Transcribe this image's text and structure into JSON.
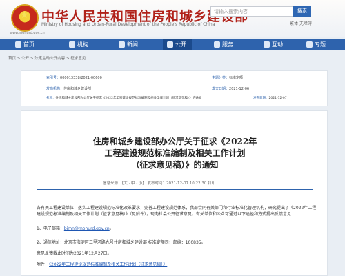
{
  "header": {
    "title_cn": "中华人民共和国住房和城乡建设部",
    "title_en": "Ministry of Housing and Urban-Rural Development of the People's Republic of China",
    "domain": "www.mohurd.gov.cn",
    "search_placeholder": "请输入搜索内容",
    "search_button": "搜索",
    "links": "繁体  无障碍"
  },
  "nav": {
    "items": [
      {
        "label": "首页",
        "icon": "home-icon"
      },
      {
        "label": "机构",
        "icon": "org-icon"
      },
      {
        "label": "新闻",
        "icon": "news-icon"
      },
      {
        "label": "公开",
        "icon": "open-icon"
      },
      {
        "label": "服务",
        "icon": "service-icon"
      },
      {
        "label": "互动",
        "icon": "interact-icon"
      },
      {
        "label": "专题",
        "icon": "topic-icon"
      }
    ],
    "active": "公开"
  },
  "breadcrumb": "首页 > 公开 > 法定主动公开内容 > 征求意见",
  "meta": {
    "index_key": "索引号：",
    "index_val": "000013338/2021-00600",
    "cat_key": "主题分类：",
    "cat_val": "标准定额",
    "org_key": "发布机构：",
    "org_val": "住房和城乡建设部",
    "date_key": "发文日期：",
    "date_val": "2021-12-06",
    "name_key": "名称：",
    "name_val": "住房和城乡建设部办公厅关于征求《2022年工程建设规范标准编制及相关工作计划（征求意见稿）》的通知",
    "pub_key": "发布日期：",
    "pub_val": "2021-12-07"
  },
  "doc": {
    "title_line1": "住房和城乡建设部办公厅关于征求《2022年",
    "title_line2": "工程建设规范标准编制及相关工作计划",
    "title_line3": "（征求意见稿）》的通知",
    "info": "信息来源：【大 · 中 · 小】    发布时间：2021-12-07 10:22:30    打印",
    "para1": "各有关工程建设单位：落实工程建设规范标准化改革要求，完善工程建设规范体系，我部会同有关部门和行业标准化管理机构，研究提出了《2022年工程建设规范标准编制及相关工作计划（征求意见稿）》（见附件），现向社会公开征求意见。有关单位和公众可通过以下途径和方式提出反馈意见：",
    "item1_label": "1、电子邮箱：",
    "item1_val": "bimn@mohurd.gov.cn",
    "item1_tail": "。",
    "item2": "2、通信地址：北京市海淀区三里河路九号住房和城乡建设部  标准定额司；邮编：100835。",
    "deadline": "意见反馈截止时间为2021年12月27日。",
    "attachment_label": "附件：",
    "attachment_link": "《2022年工程建设规范标准编制及相关工作计划（征求意见稿）》"
  }
}
